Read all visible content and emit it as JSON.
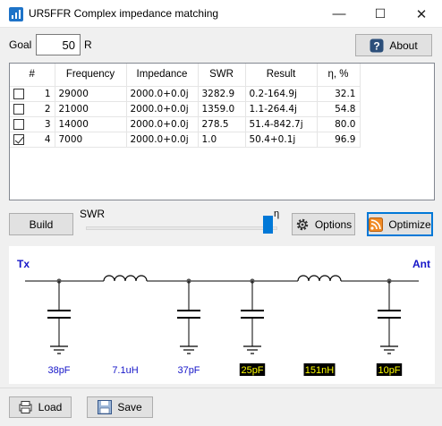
{
  "window": {
    "title": "UR5FFR Complex impedance matching",
    "minimize_glyph": "—",
    "maximize_glyph": "☐",
    "close_glyph": "✕"
  },
  "goal": {
    "label": "Goal",
    "value": "50",
    "unit": "R"
  },
  "buttons": {
    "about": "About",
    "build": "Build",
    "options": "Options",
    "optimize": "Optimize",
    "load": "Load",
    "save": "Save"
  },
  "table": {
    "headers": [
      "#",
      "Frequency",
      "Impedance",
      "SWR",
      "Result",
      "η, %"
    ],
    "rows": [
      {
        "checked": false,
        "n": "1",
        "freq": "29000",
        "imp": "2000.0+0.0j",
        "swr": "3282.9",
        "result": "0.2-164.9j",
        "eta": "32.1"
      },
      {
        "checked": false,
        "n": "2",
        "freq": "21000",
        "imp": "2000.0+0.0j",
        "swr": "1359.0",
        "result": "1.1-264.4j",
        "eta": "54.8"
      },
      {
        "checked": false,
        "n": "3",
        "freq": "14000",
        "imp": "2000.0+0.0j",
        "swr": "278.5",
        "result": "51.4-842.7j",
        "eta": "80.0"
      },
      {
        "checked": true,
        "n": "4",
        "freq": "7000",
        "imp": "2000.0+0.0j",
        "swr": "1.0",
        "result": "50.4+0.1j",
        "eta": "96.9"
      }
    ]
  },
  "slider": {
    "left_label": "SWR",
    "right_label": "η",
    "level_fraction": 0.95
  },
  "schematic": {
    "tx_label": "Tx",
    "ant_label": "Ant",
    "components": [
      {
        "type": "capacitor",
        "value": "38pF",
        "highlight": false
      },
      {
        "type": "inductor",
        "value": "7.1uH",
        "highlight": false
      },
      {
        "type": "capacitor",
        "value": "37pF",
        "highlight": false
      },
      {
        "type": "capacitor",
        "value": "25pF",
        "highlight": true
      },
      {
        "type": "inductor",
        "value": "151nH",
        "highlight": true
      },
      {
        "type": "capacitor",
        "value": "10pF",
        "highlight": true
      }
    ],
    "colors": {
      "label": "#1515c8",
      "highlight_bg": "#000000",
      "highlight_fg": "#ffff00",
      "node": "#555555"
    }
  }
}
